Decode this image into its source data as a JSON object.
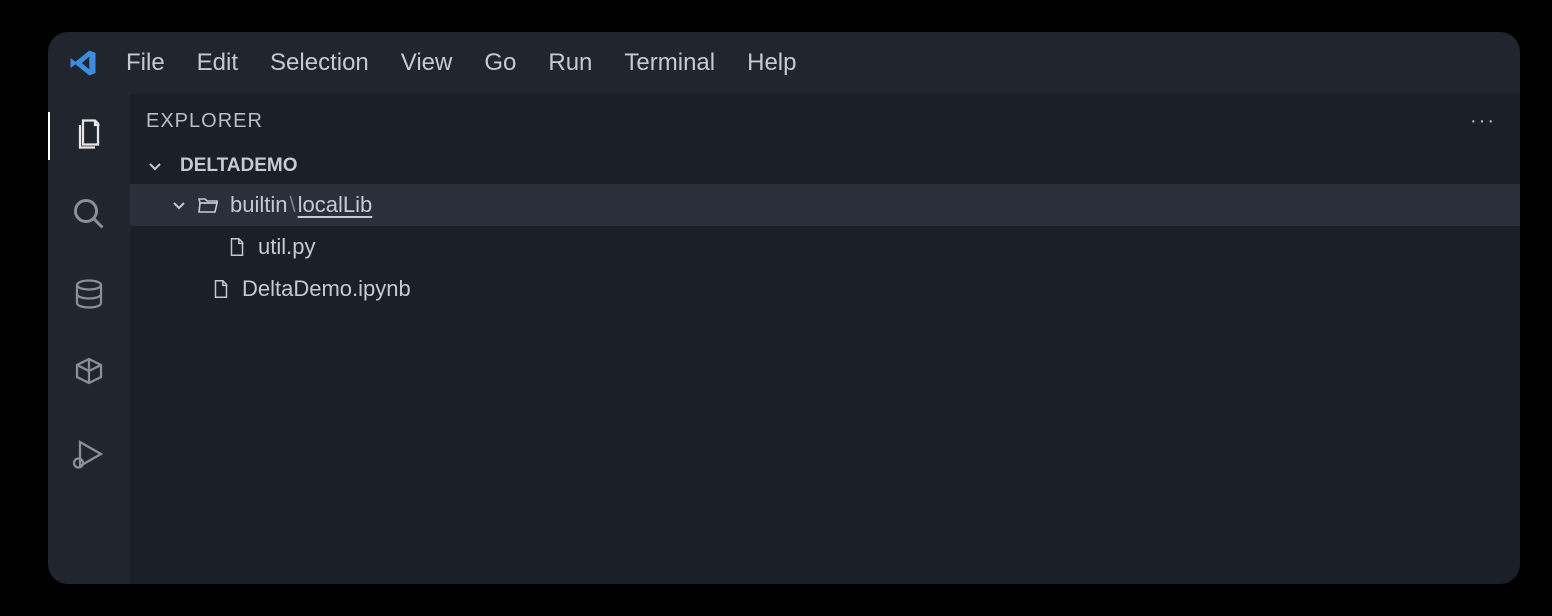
{
  "menu": {
    "items": [
      "File",
      "Edit",
      "Selection",
      "View",
      "Go",
      "Run",
      "Terminal",
      "Help"
    ]
  },
  "explorer": {
    "title": "EXPLORER",
    "project_name": "DELTADEMO",
    "folder": {
      "path_prefix": "builtin",
      "path_separator": "\\",
      "path_last": "localLib",
      "children": [
        {
          "name": "util.py"
        }
      ]
    },
    "root_files": [
      {
        "name": "DeltaDemo.ipynb"
      }
    ]
  }
}
